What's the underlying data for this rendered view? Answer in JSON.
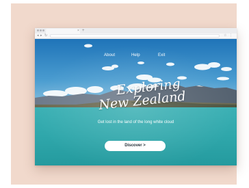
{
  "nav": {
    "items": [
      {
        "label": "About"
      },
      {
        "label": "Help"
      },
      {
        "label": "Exit"
      }
    ]
  },
  "hero": {
    "title_line1": "Exploring",
    "title_line2": "New Zealand",
    "tagline": "Get lost in the land of the long white cloud",
    "cta_label": "Discover >"
  },
  "browser": {
    "tab_close_glyph": "×",
    "new_tab_glyph": "+"
  },
  "colors": {
    "frame_background": "#f1d9cc",
    "sky": "#2f86c4",
    "lake": "#3fb3b6",
    "cta_text": "#1f2b33"
  }
}
